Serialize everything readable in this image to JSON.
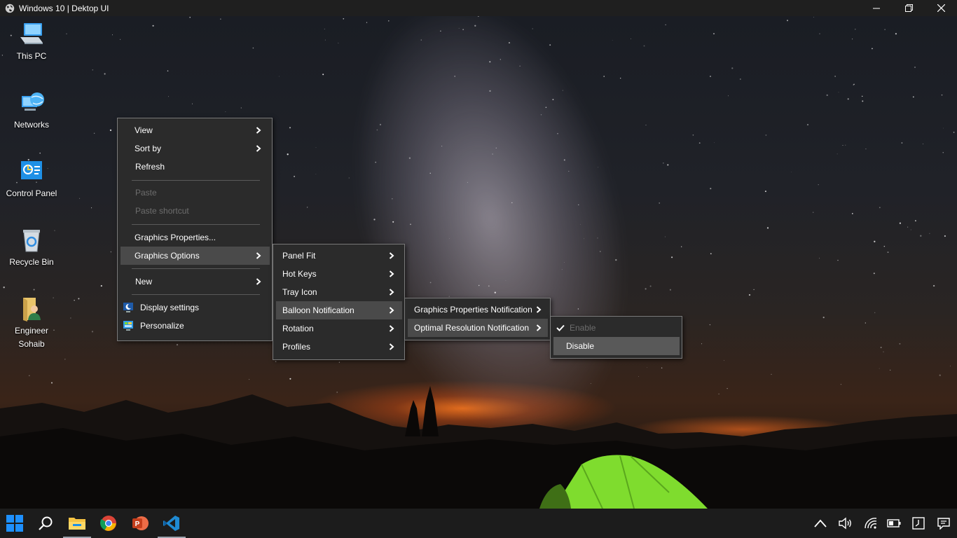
{
  "window": {
    "title": "Windows 10 | Dektop UI",
    "icon": "globe-icon",
    "controls": [
      "minimize-icon",
      "restore-icon",
      "close-icon"
    ]
  },
  "desktop_icons": [
    {
      "label": "This PC",
      "icon": "computer-icon"
    },
    {
      "label": "Networks",
      "icon": "network-icon"
    },
    {
      "label": "Control Panel",
      "icon": "control-panel-icon"
    },
    {
      "label": "Recycle Bin",
      "icon": "recycle-bin-icon"
    },
    {
      "label": "Engineer Sohaib",
      "icon": "user-folder-icon"
    }
  ],
  "context_menu": {
    "items": [
      {
        "label": "View",
        "submenu": true
      },
      {
        "label": "Sort by",
        "submenu": true
      },
      {
        "label": "Refresh"
      },
      {
        "label": "Paste",
        "disabled": true
      },
      {
        "label": "Paste shortcut",
        "disabled": true
      },
      {
        "label": "Graphics Properties..."
      },
      {
        "label": "Graphics Options",
        "submenu": true,
        "highlighted": true
      },
      {
        "label": "New",
        "submenu": true
      },
      {
        "label": "Display settings",
        "icon": "display-settings-icon"
      },
      {
        "label": "Personalize",
        "icon": "personalize-icon"
      }
    ]
  },
  "graphics_options_menu": {
    "items": [
      {
        "label": "Panel Fit",
        "submenu": true
      },
      {
        "label": "Hot Keys",
        "submenu": true
      },
      {
        "label": "Tray Icon",
        "submenu": true
      },
      {
        "label": "Balloon Notification",
        "submenu": true,
        "highlighted": true
      },
      {
        "label": "Rotation",
        "submenu": true
      },
      {
        "label": "Profiles",
        "submenu": true
      }
    ]
  },
  "balloon_menu": {
    "items": [
      {
        "label": "Graphics Properties Notification",
        "submenu": true
      },
      {
        "label": "Optimal Resolution Notification",
        "submenu": true,
        "highlighted": true
      }
    ]
  },
  "optimal_menu": {
    "items": [
      {
        "label": "Enable",
        "checked": true,
        "disabled": true
      },
      {
        "label": "Disable",
        "highlighted": true
      }
    ]
  },
  "taskbar": {
    "apps": [
      "windows-start-icon",
      "search-icon",
      "file-explorer-icon",
      "chrome-icon",
      "powerpoint-icon",
      "vscode-icon"
    ],
    "active_app": "vscode-icon",
    "tray": [
      "chevron-up-icon",
      "volume-icon",
      "wifi-icon",
      "battery-icon",
      "clock-icon",
      "notification-icon"
    ]
  },
  "colors": {
    "menu_bg": "#2b2b2b",
    "menu_highlight": "#4a4a4a",
    "taskbar_bg": "#1c1c1c",
    "tent_green": "#7fdc2e"
  }
}
